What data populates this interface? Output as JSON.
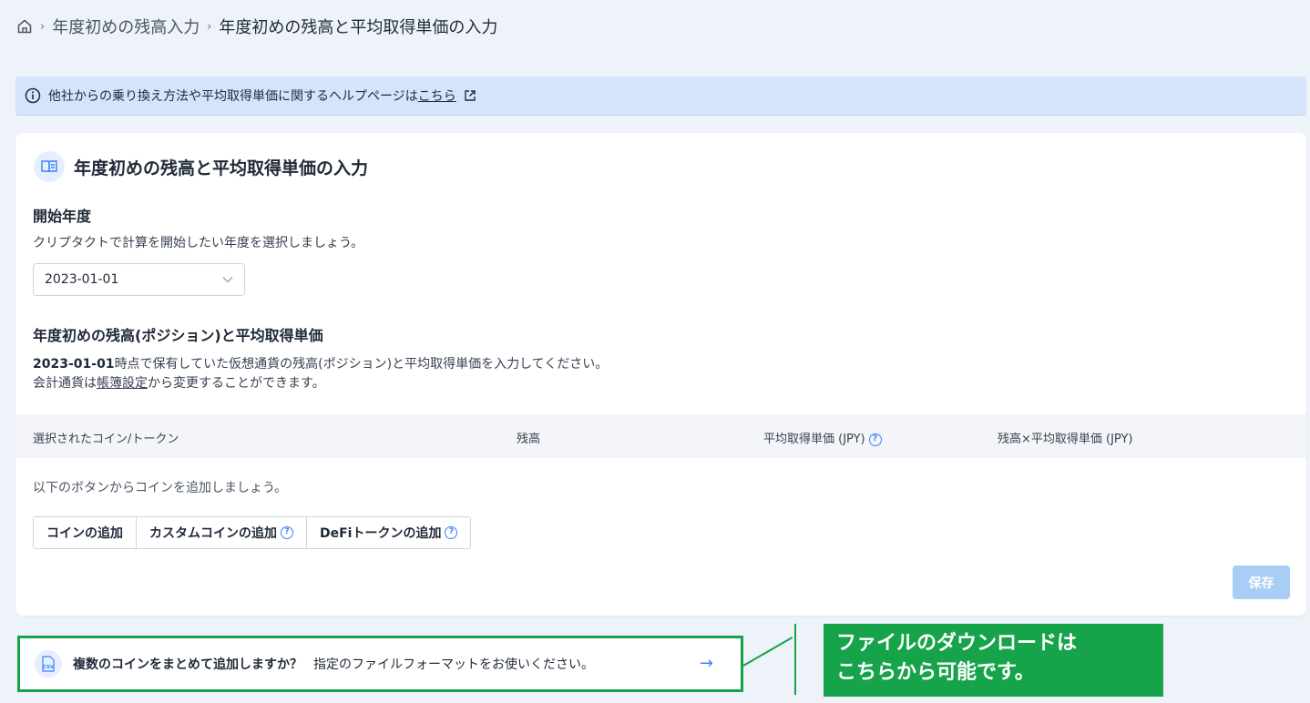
{
  "breadcrumb": {
    "home_icon": "home-icon",
    "item1": "年度初めの残高入力",
    "item2": "年度初めの残高と平均取得単価の入力"
  },
  "banner": {
    "text": "他社からの乗り換え方法や平均取得単価に関するヘルプページは",
    "link": "こちら"
  },
  "card": {
    "title": "年度初めの残高と平均取得単価の入力",
    "start_label": "開始年度",
    "start_desc": "クリプタクトで計算を開始したい年度を選択しましょう。",
    "start_value": "2023-01-01",
    "balance_label": "年度初めの残高(ポジション)と平均取得単価",
    "balance_date": "2023-01-01",
    "balance_desc1": "時点で保有していた仮想通貨の残高(ポジション)と平均取得単価を入力してください。",
    "balance_desc2_prefix": "会計通貨は",
    "balance_desc2_link": "帳簿設定",
    "balance_desc2_suffix": "から変更することができます。",
    "table_headers": [
      "選択されたコイン/トークン",
      "残高",
      "平均取得単価 (JPY)",
      "残高×平均取得単価 (JPY)"
    ],
    "empty_msg": "以下のボタンからコインを追加しましょう。",
    "buttons": [
      "コインの追加",
      "カスタムコインの追加",
      "DeFiトークンの追加"
    ],
    "save": "保存"
  },
  "csv_bar": {
    "question": "複数のコインをまとめて追加しますか？",
    "hint": "指定のファイルフォーマットをお使いください。",
    "arrow": "→"
  },
  "callout": {
    "line1": "ファイルのダウンロードは",
    "line2": "こちらから可能です。"
  },
  "colors": {
    "accent": "#3b82f6",
    "callout_green": "#16a34a",
    "save_disabled": "#a9cdf4",
    "banner": "#d6e4fb"
  }
}
